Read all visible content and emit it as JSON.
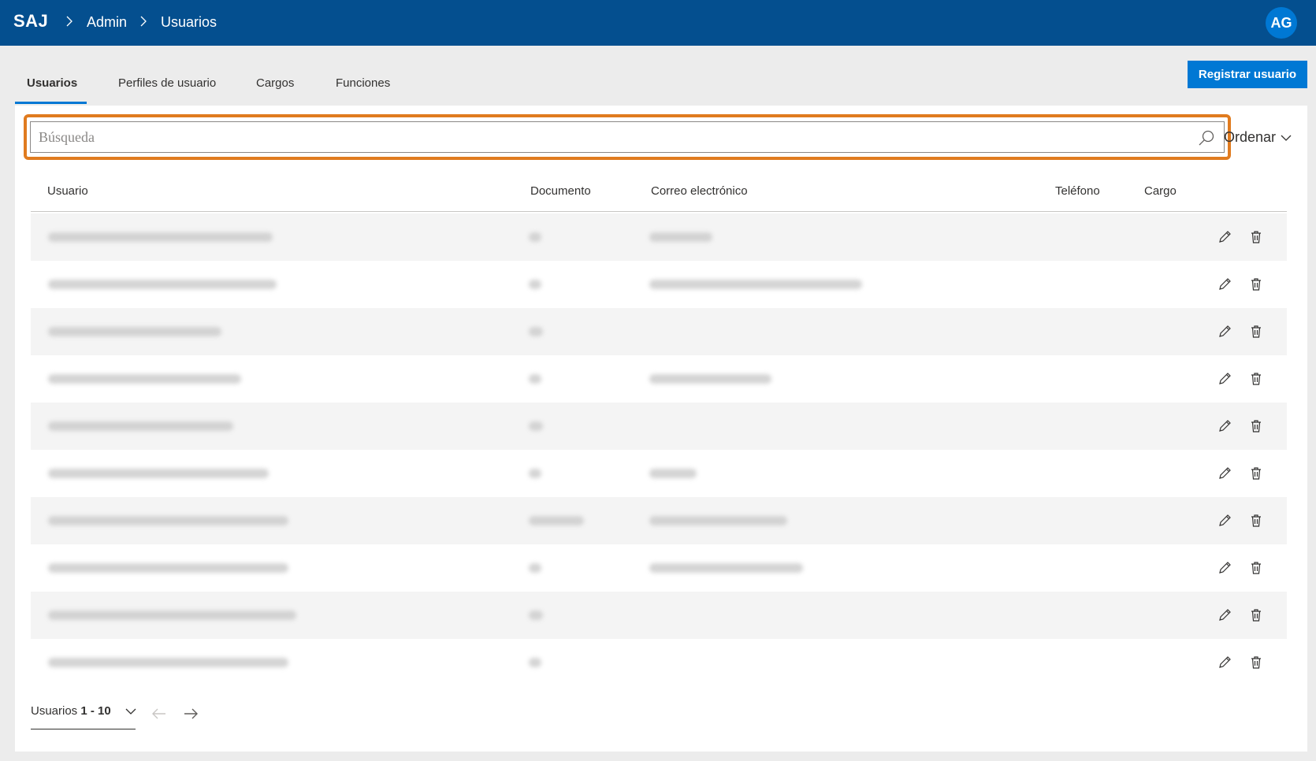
{
  "header": {
    "brand": "SAJ",
    "breadcrumbs": [
      "Admin",
      "Usuarios"
    ],
    "avatar_initials": "AG",
    "bar_color": "#044f8f"
  },
  "tabs": [
    {
      "label": "Usuarios",
      "active": true
    },
    {
      "label": "Perfiles de usuario",
      "active": false
    },
    {
      "label": "Cargos",
      "active": false
    },
    {
      "label": "Funciones",
      "active": false
    }
  ],
  "actions": {
    "register_label": "Registrar usuario",
    "sort_label": "Ordenar"
  },
  "search": {
    "placeholder": "Búsqueda",
    "value": "",
    "highlight_color": "#e07b1f"
  },
  "table": {
    "columns": [
      "Usuario",
      "Documento",
      "Correo electrónico",
      "Teléfono",
      "Cargo"
    ],
    "row_actions": [
      "pencil-icon",
      "trash-icon"
    ],
    "row_count": 10
  },
  "pagination": {
    "label": "Usuarios",
    "range": "1 - 10"
  }
}
